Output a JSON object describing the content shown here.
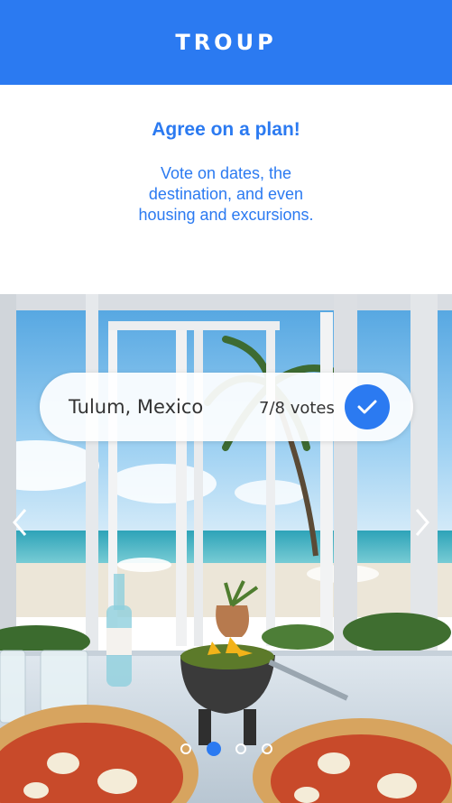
{
  "header": {
    "brand": "TROUP"
  },
  "intro": {
    "title": "Agree on a plan!",
    "description": "Vote on dates, the destination, and even housing and excursions."
  },
  "carousel": {
    "vote_card": {
      "destination": "Tulum, Mexico",
      "votes": "7/8 votes",
      "check_icon": "checkmark-icon"
    },
    "prev_icon": "chevron-left-icon",
    "next_icon": "chevron-right-icon",
    "dots": {
      "count": 4,
      "active_index": 1
    }
  },
  "colors": {
    "accent": "#2b7af1",
    "header_bg": "#2b7af1"
  }
}
